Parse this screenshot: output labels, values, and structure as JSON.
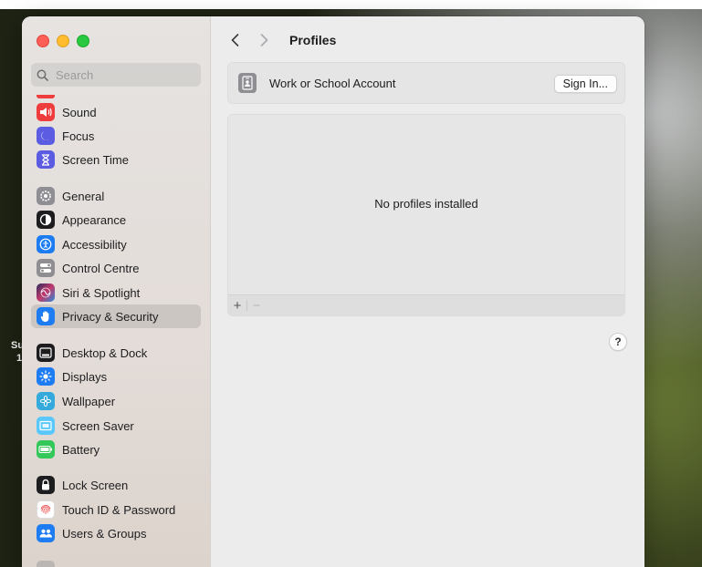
{
  "desktop": {
    "label_line1": "Su",
    "label_line2": "1"
  },
  "window": {
    "search": {
      "placeholder": "Search"
    },
    "sidebar": {
      "items": [
        {
          "label": "Sound",
          "icon": "speaker-icon",
          "color": "#ef3c3c"
        },
        {
          "label": "Focus",
          "icon": "moon-icon",
          "color": "#5b5ce2"
        },
        {
          "label": "Screen Time",
          "icon": "hourglass-icon",
          "color": "#5b5ce2"
        },
        {
          "label": "General",
          "icon": "gear-icon",
          "color": "#8e8e93"
        },
        {
          "label": "Appearance",
          "icon": "appearance-icon",
          "color": "#1d1d1f"
        },
        {
          "label": "Accessibility",
          "icon": "accessibility-icon",
          "color": "#1e7cf2"
        },
        {
          "label": "Control Centre",
          "icon": "toggles-icon",
          "color": "#8e8e93"
        },
        {
          "label": "Siri & Spotlight",
          "icon": "siri-icon",
          "color": "#3d3d8a"
        },
        {
          "label": "Privacy & Security",
          "icon": "hand-icon",
          "color": "#1e7cf2",
          "selected": true
        },
        {
          "label": "Desktop & Dock",
          "icon": "dock-icon",
          "color": "#1d1d1f"
        },
        {
          "label": "Displays",
          "icon": "sun-icon",
          "color": "#1e7cf2"
        },
        {
          "label": "Wallpaper",
          "icon": "flower-icon",
          "color": "#34aadc"
        },
        {
          "label": "Screen Saver",
          "icon": "screensaver-icon",
          "color": "#5ac8fa"
        },
        {
          "label": "Battery",
          "icon": "battery-icon",
          "color": "#34c759"
        },
        {
          "label": "Lock Screen",
          "icon": "lock-icon",
          "color": "#1d1d1f"
        },
        {
          "label": "Touch ID & Password",
          "icon": "fingerprint-icon",
          "color": "#f25c5c"
        },
        {
          "label": "Users & Groups",
          "icon": "users-icon",
          "color": "#1e7cf2"
        }
      ]
    },
    "content": {
      "title": "Profiles",
      "account": {
        "label": "Work or School Account",
        "button": "Sign In..."
      },
      "profiles": {
        "empty_message": "No profiles installed",
        "add": "+",
        "remove": "−"
      },
      "help": "?"
    }
  }
}
